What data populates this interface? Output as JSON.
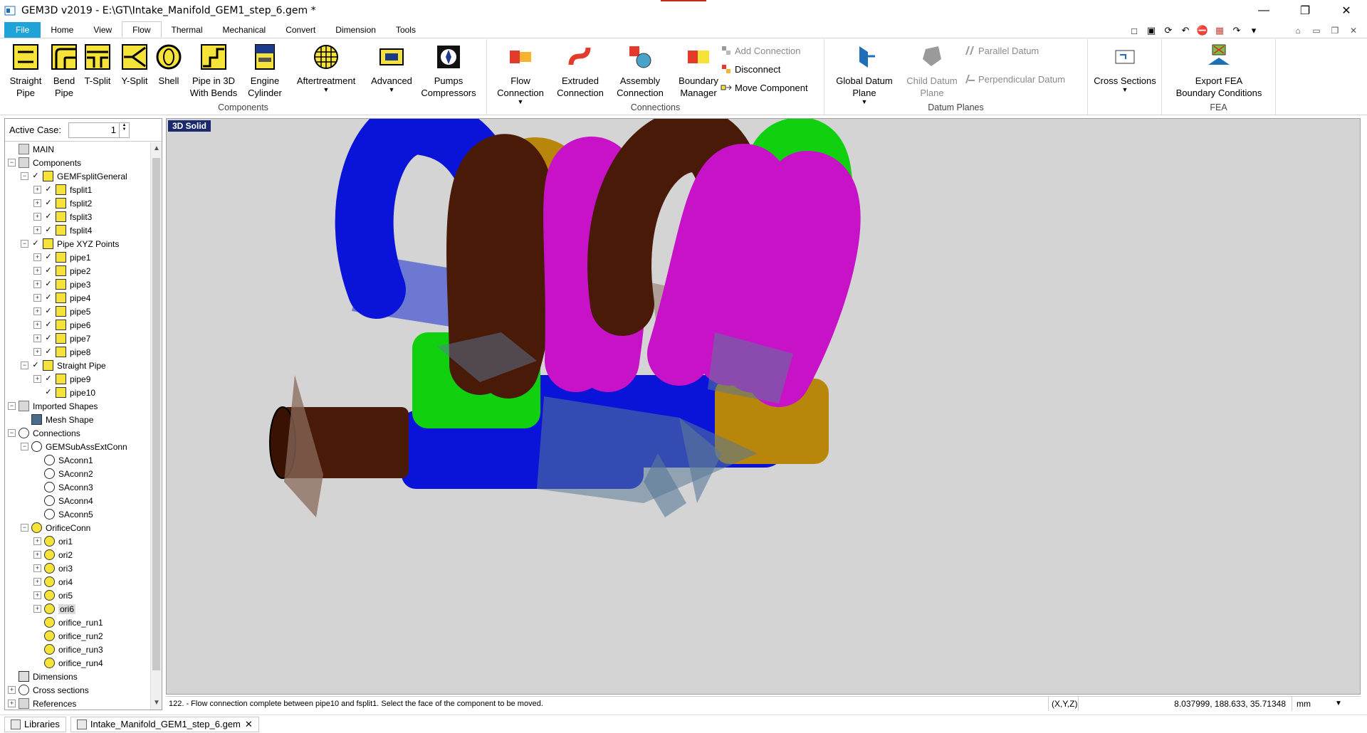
{
  "window": {
    "title": "GEM3D v2019 - E:\\GT\\Intake_Manifold_GEM1_step_6.gem *",
    "minimize": "—",
    "restore": "❐",
    "close": "✕"
  },
  "tabs": [
    "File",
    "Home",
    "View",
    "Flow",
    "Thermal",
    "Mechanical",
    "Convert",
    "Dimension",
    "Tools"
  ],
  "ribbon": {
    "components": {
      "label": "Components",
      "buttons": [
        {
          "l1": "Straight",
          "l2": "Pipe"
        },
        {
          "l1": "Bend",
          "l2": "Pipe"
        },
        {
          "l1": "T-Split",
          "l2": ""
        },
        {
          "l1": "Y-Split",
          "l2": ""
        },
        {
          "l1": "Shell",
          "l2": ""
        },
        {
          "l1": "Pipe in 3D",
          "l2": "With Bends"
        },
        {
          "l1": "Engine",
          "l2": "Cylinder"
        },
        {
          "l1": "Aftertreatment",
          "l2": ""
        },
        {
          "l1": "Advanced",
          "l2": ""
        },
        {
          "l1": "Pumps",
          "l2": "Compressors"
        }
      ]
    },
    "connections": {
      "label": "Connections",
      "buttons": [
        {
          "l1": "Flow",
          "l2": "Connection"
        },
        {
          "l1": "Extruded",
          "l2": "Connection"
        },
        {
          "l1": "Assembly",
          "l2": "Connection"
        },
        {
          "l1": "Boundary",
          "l2": "Manager"
        }
      ],
      "small": [
        "Add Connection",
        "Disconnect",
        "Move Component"
      ]
    },
    "datum": {
      "label": "Datum Planes",
      "buttons": [
        {
          "l1": "Global Datum",
          "l2": "Plane"
        },
        {
          "l1": "Child Datum",
          "l2": "Plane"
        }
      ],
      "small": [
        "Parallel Datum",
        "Perpendicular Datum"
      ]
    },
    "cross": {
      "l1": "Cross Sections"
    },
    "fea": {
      "label": "FEA",
      "l1": "Export FEA",
      "l2": "Boundary Conditions"
    }
  },
  "left": {
    "active_case_label": "Active Case:",
    "active_case_value": "1",
    "tree": [
      {
        "label": "MAIN",
        "level": 0,
        "icon": "gray",
        "exp": ""
      },
      {
        "label": "Components",
        "level": 0,
        "icon": "gray",
        "exp": "−"
      },
      {
        "label": "GEMFsplitGeneral",
        "level": 1,
        "icon": "yellow",
        "exp": "−",
        "chk": true
      },
      {
        "label": "fsplit1",
        "level": 2,
        "icon": "yellow",
        "exp": "+",
        "chk": true
      },
      {
        "label": "fsplit2",
        "level": 2,
        "icon": "yellow",
        "exp": "+",
        "chk": true
      },
      {
        "label": "fsplit3",
        "level": 2,
        "icon": "yellow",
        "exp": "+",
        "chk": true
      },
      {
        "label": "fsplit4",
        "level": 2,
        "icon": "yellow",
        "exp": "+",
        "chk": true
      },
      {
        "label": "Pipe XYZ Points",
        "level": 1,
        "icon": "yellow",
        "exp": "−",
        "chk": true
      },
      {
        "label": "pipe1",
        "level": 2,
        "icon": "yellow",
        "exp": "+",
        "chk": true
      },
      {
        "label": "pipe2",
        "level": 2,
        "icon": "yellow",
        "exp": "+",
        "chk": true
      },
      {
        "label": "pipe3",
        "level": 2,
        "icon": "yellow",
        "exp": "+",
        "chk": true
      },
      {
        "label": "pipe4",
        "level": 2,
        "icon": "yellow",
        "exp": "+",
        "chk": true
      },
      {
        "label": "pipe5",
        "level": 2,
        "icon": "yellow",
        "exp": "+",
        "chk": true
      },
      {
        "label": "pipe6",
        "level": 2,
        "icon": "yellow",
        "exp": "+",
        "chk": true
      },
      {
        "label": "pipe7",
        "level": 2,
        "icon": "yellow",
        "exp": "+",
        "chk": true
      },
      {
        "label": "pipe8",
        "level": 2,
        "icon": "yellow",
        "exp": "+",
        "chk": true
      },
      {
        "label": "Straight Pipe",
        "level": 1,
        "icon": "yellow",
        "exp": "−",
        "chk": true
      },
      {
        "label": "pipe9",
        "level": 2,
        "icon": "yellow",
        "exp": "+",
        "chk": true
      },
      {
        "label": "pipe10",
        "level": 2,
        "icon": "yellow",
        "exp": "",
        "chk": true
      },
      {
        "label": "Imported Shapes",
        "level": 0,
        "icon": "gray",
        "exp": "−"
      },
      {
        "label": "Mesh Shape",
        "level": 1,
        "icon": "mesh",
        "exp": ""
      },
      {
        "label": "Connections",
        "level": 0,
        "icon": "circle",
        "exp": "−"
      },
      {
        "label": "GEMSubAssExtConn",
        "level": 1,
        "icon": "conn",
        "exp": "−"
      },
      {
        "label": "SAconn1",
        "level": 2,
        "icon": "conn",
        "exp": ""
      },
      {
        "label": "SAconn2",
        "level": 2,
        "icon": "conn",
        "exp": ""
      },
      {
        "label": "SAconn3",
        "level": 2,
        "icon": "conn",
        "exp": ""
      },
      {
        "label": "SAconn4",
        "level": 2,
        "icon": "conn",
        "exp": ""
      },
      {
        "label": "SAconn5",
        "level": 2,
        "icon": "conn",
        "exp": ""
      },
      {
        "label": "OrificeConn",
        "level": 1,
        "icon": "orif",
        "exp": "−"
      },
      {
        "label": "ori1",
        "level": 2,
        "icon": "orif",
        "exp": "+"
      },
      {
        "label": "ori2",
        "level": 2,
        "icon": "orif",
        "exp": "+"
      },
      {
        "label": "ori3",
        "level": 2,
        "icon": "orif",
        "exp": "+"
      },
      {
        "label": "ori4",
        "level": 2,
        "icon": "orif",
        "exp": "+"
      },
      {
        "label": "ori5",
        "level": 2,
        "icon": "orif",
        "exp": "+"
      },
      {
        "label": "ori6",
        "level": 2,
        "icon": "orif",
        "exp": "+",
        "selected": true
      },
      {
        "label": "orifice_run1",
        "level": 2,
        "icon": "orif",
        "exp": ""
      },
      {
        "label": "orifice_run2",
        "level": 2,
        "icon": "orif",
        "exp": ""
      },
      {
        "label": "orifice_run3",
        "level": 2,
        "icon": "orif",
        "exp": ""
      },
      {
        "label": "orifice_run4",
        "level": 2,
        "icon": "orif",
        "exp": ""
      },
      {
        "label": "Dimensions",
        "level": 0,
        "icon": "dims",
        "exp": ""
      },
      {
        "label": "Cross sections",
        "level": 0,
        "icon": "circle",
        "exp": "+"
      },
      {
        "label": "References",
        "level": 0,
        "icon": "gray",
        "exp": "+"
      }
    ]
  },
  "viewport": {
    "label": "3D Solid"
  },
  "status": {
    "message": "122. - Flow connection complete between pipe10 and fsplit1. Select the face of the component to be moved.",
    "coord_label": "(X,Y,Z)",
    "coord_value": "8.037999, 188.633, 35.71348",
    "unit": "mm"
  },
  "bottom_tabs": [
    "Libraries",
    "Intake_Manifold_GEM1_step_6.gem"
  ],
  "colors": {
    "blue": "#0a14d8",
    "brown": "#4a1a08",
    "magenta": "#c812c8",
    "green": "#10d010",
    "gold": "#b8860b",
    "plane": "#5a7898"
  }
}
